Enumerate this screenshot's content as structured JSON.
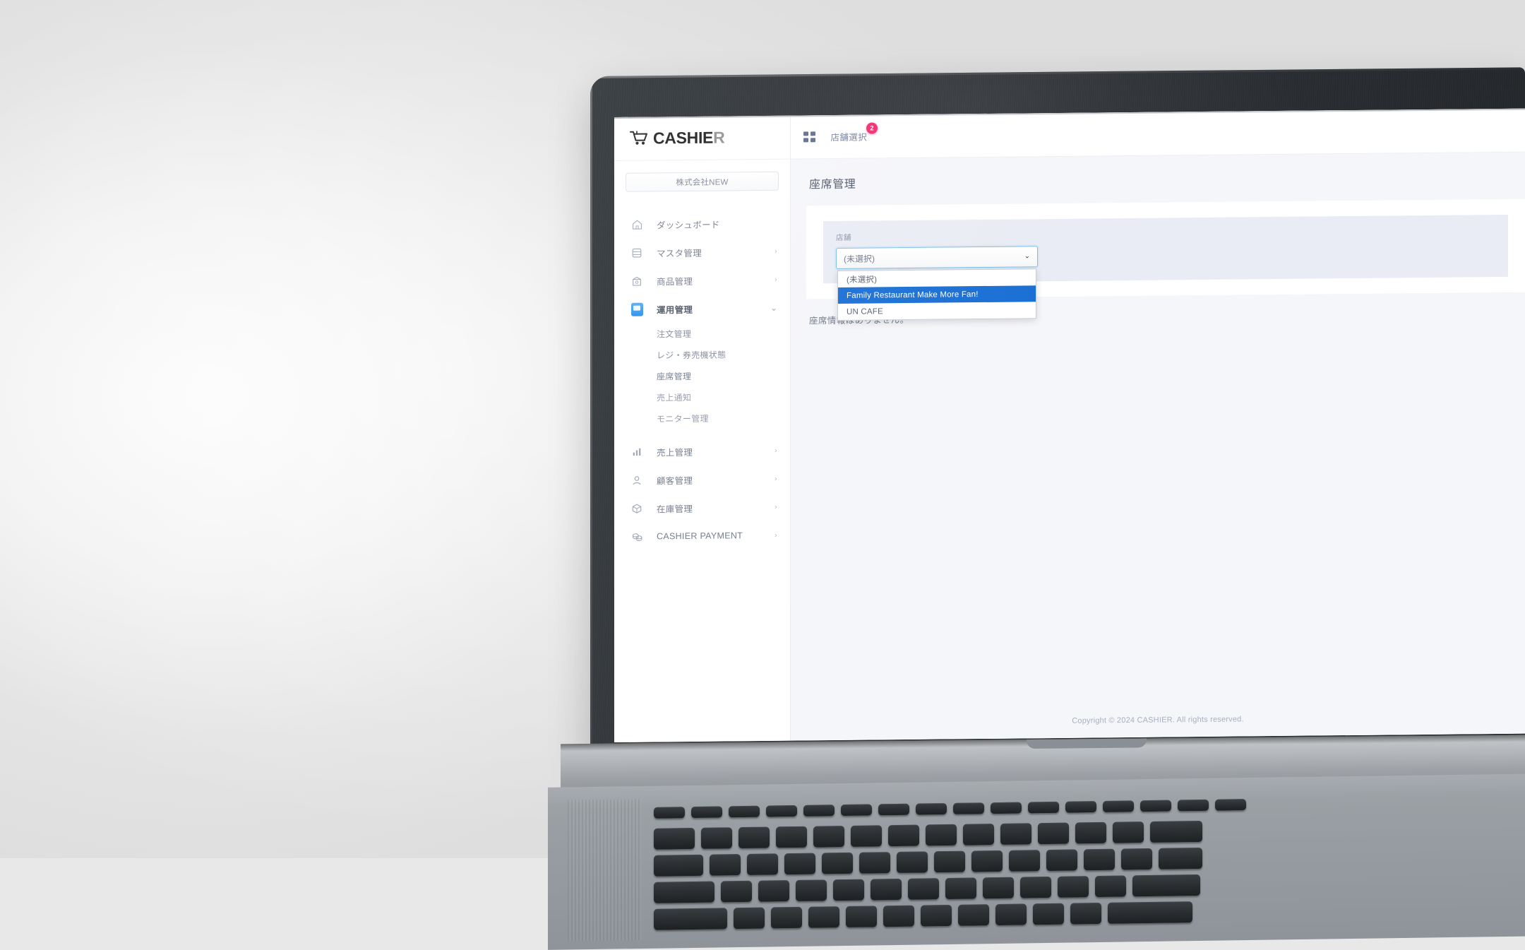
{
  "brand": {
    "name_dark": "CASHIE",
    "name_accent": "R",
    "cart_icon": "shopping-cart-icon"
  },
  "sidebar": {
    "company_selector": "株式会社NEW",
    "items": [
      {
        "label": "ダッシュボード",
        "icon": "home-icon",
        "chevron": "",
        "active": false
      },
      {
        "label": "マスタ管理",
        "icon": "database-icon",
        "chevron": "›",
        "active": false
      },
      {
        "label": "商品管理",
        "icon": "box-product-icon",
        "chevron": "›",
        "active": false
      },
      {
        "label": "運用管理",
        "icon": "monitor-icon",
        "chevron": "⌄",
        "active": true
      }
    ],
    "subitems": [
      {
        "label": "注文管理"
      },
      {
        "label": "レジ・券売機状態"
      },
      {
        "label": "座席管理"
      },
      {
        "label": "売上通知"
      },
      {
        "label": "モニター管理"
      }
    ],
    "items_lower": [
      {
        "label": "売上管理",
        "icon": "bar-chart-icon",
        "chevron": "›"
      },
      {
        "label": "顧客管理",
        "icon": "user-icon",
        "chevron": "›"
      },
      {
        "label": "在庫管理",
        "icon": "package-icon",
        "chevron": "›"
      },
      {
        "label": "CASHIER PAYMENT",
        "icon": "payment-coins-icon",
        "chevron": "›"
      }
    ]
  },
  "topbar": {
    "grid_icon": "grid-menu-icon",
    "store_select_label": "店舗選択",
    "store_badge_count": "2"
  },
  "page": {
    "title": "座席管理",
    "field_label": "店舗",
    "select_value": "(未選択)",
    "select_chevron": "⌄",
    "options": [
      {
        "label": "(未選択)",
        "selected": false
      },
      {
        "label": "Family Restaurant Make More Fan!",
        "selected": true
      },
      {
        "label": "UN CAFE",
        "selected": false
      }
    ],
    "empty_message": "座席情報はありません。"
  },
  "footer": {
    "copyright": "Copyright © 2024 CASHIER. All rights reserved."
  },
  "colors": {
    "accent_blue": "#1a6fd4",
    "badge_pink": "#f5296e",
    "active_icon": "#2196f3",
    "panel_bg": "#e9ecf4",
    "page_bg": "#f5f6fa"
  }
}
